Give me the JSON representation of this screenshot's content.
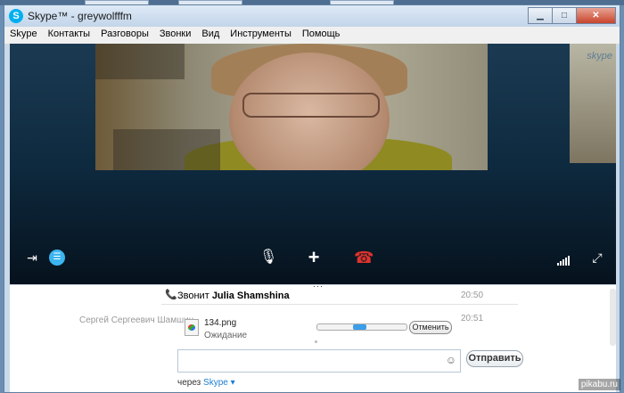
{
  "window": {
    "title": "Skype™ - greywolfffm"
  },
  "menu": [
    "Skype",
    "Контакты",
    "Разговоры",
    "Звонки",
    "Вид",
    "Инструменты",
    "Помощь"
  ],
  "video": {
    "watermark": "skype"
  },
  "chat": {
    "call_prefix": "Звонит",
    "caller": "Julia Shamshina",
    "call_time": "20:50",
    "sender": "Сергей Сергеевич Шамшин",
    "file_time": "20:51",
    "file_name": "134.png",
    "file_status": "Ожидание",
    "transfer_progress": 0.55,
    "cancel_label": "Отменить",
    "send_label": "Отправить",
    "via_prefix": "через",
    "via_link": "Skype"
  },
  "watermark_site": "pikabu.ru",
  "colors": {
    "accent": "#00aff0",
    "hangup": "#e0332c"
  }
}
